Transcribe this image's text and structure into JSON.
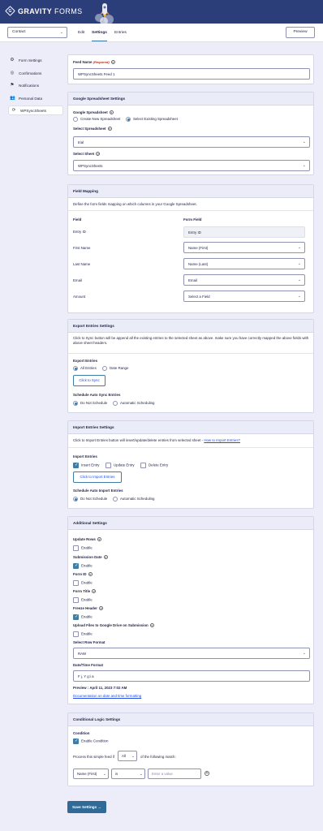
{
  "header": {
    "logo_mark": "G",
    "logo_bold": "GRAVITY",
    "logo_light": " FORMS"
  },
  "topbar": {
    "form_select": "Contact",
    "tabs": [
      "Edit",
      "Settings",
      "Entries"
    ],
    "preview": "Preview"
  },
  "sidebar": {
    "items": [
      {
        "label": "Form Settings",
        "icon": "gear-icon"
      },
      {
        "label": "Confirmations",
        "icon": "check-circle-icon"
      },
      {
        "label": "Notifications",
        "icon": "flag-icon"
      },
      {
        "label": "Personal Data",
        "icon": "users-icon"
      },
      {
        "label": "WPSyncSheets",
        "icon": "sync-icon"
      }
    ]
  },
  "feed": {
    "label": "Feed Name",
    "required": "(Required)",
    "value": "WPSyncSheets Feed 1"
  },
  "gss": {
    "title": "Google Spreadsheet Settings",
    "label": "Google Spreadsheet",
    "opt_create": "Create New Spreadsheet",
    "opt_existing": "Select Existing Spreadsheet",
    "select_spreadsheet_label": "Select Spreadsheet",
    "spreadsheet_value": "trial",
    "select_sheet_label": "Select Sheet",
    "sheet_value": "WPSyncSheets"
  },
  "mapping": {
    "title": "Field Mapping",
    "desc": "Define the form fields mapping on which columns in your Google Spreadsheet.",
    "col_field": "Field",
    "col_form_field": "Form Field",
    "rows": [
      {
        "field": "Entry ID",
        "value": "Entry ID"
      },
      {
        "field": "First Name",
        "value": "Name (First)"
      },
      {
        "field": "Last Name",
        "value": "Name (Last)"
      },
      {
        "field": "Email",
        "value": "Email"
      },
      {
        "field": "Amount",
        "value": "Select a Field"
      }
    ]
  },
  "export": {
    "title": "Export Entries Settings",
    "desc": "Click to Sync button will be append all the existing entries to the selected sheet as above. make sure you have correctly mapped the above fields with above sheet headers.",
    "label": "Export Entries",
    "opt_all": "All Entries",
    "opt_range": "Date Range",
    "button": "Click to Sync",
    "schedule_label": "Schedule Auto Sync Entries",
    "opt_no": "Do Not Schedule",
    "opt_auto": "Automatic Scheduling"
  },
  "import": {
    "title": "Import Entries Settings",
    "desc": "Click to Import Entries button will insert/update/delete entries from selected sheet - ",
    "desc_link": "How to Import Entries?",
    "label": "Import Entries",
    "opt_insert": "Insert Entry",
    "opt_update": "Update Entry",
    "opt_delete": "Delete Entry",
    "button": "Click to Import Entries",
    "schedule_label": "Schedule Auto Import Entries",
    "opt_no": "Do Not Schedule",
    "opt_auto": "Automatic Scheduling"
  },
  "additional": {
    "title": "Additional Settings",
    "enable": "Enable",
    "update_rows": "Update Rows",
    "submission_date": "Submission Date",
    "form_id": "Form ID",
    "form_title": "Form Title",
    "freeze_header": "Freeze Header",
    "upload_files": "Upload Files to Google Drive on Submission",
    "row_format_label": "Select Row Format",
    "row_format_value": "RAW",
    "datetime_label": "Date/Time Format",
    "datetime_value": "F j, Y g:i a",
    "preview": "Preview : April 11, 2023 7:02 AM",
    "doc_link": "Documentation on date and time formatting"
  },
  "logic": {
    "title": "Conditional Logic Settings",
    "label": "Condition",
    "enable": "Enable Condition",
    "process_prefix": "Process this simple feed if",
    "match_value": "All",
    "process_suffix": "of the following match:",
    "field": "Name (First)",
    "operator": "is",
    "value_placeholder": "Enter a value"
  },
  "save": {
    "label": "Save Settings →"
  }
}
